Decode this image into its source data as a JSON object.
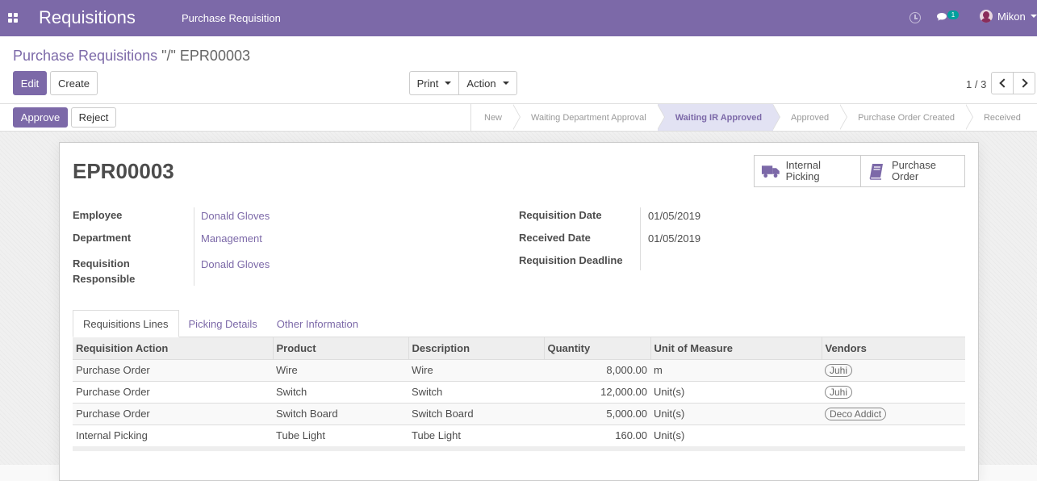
{
  "navbar": {
    "app_title": "Requisitions",
    "menu_item": "Purchase Requisition",
    "chat_count": "1",
    "user_name": "Mikon"
  },
  "breadcrumb": {
    "parent": "Purchase Requisitions",
    "separator": "\"/\"",
    "current": "EPR00003"
  },
  "toolbar": {
    "edit_label": "Edit",
    "create_label": "Create",
    "print_label": "Print",
    "action_label": "Action"
  },
  "pager": {
    "value": "1 / 3"
  },
  "status_buttons": {
    "approve_label": "Approve",
    "reject_label": "Reject"
  },
  "stages": [
    {
      "label": "New",
      "active": false
    },
    {
      "label": "Waiting Department Approval",
      "active": false
    },
    {
      "label": "Waiting IR Approved",
      "active": true
    },
    {
      "label": "Approved",
      "active": false
    },
    {
      "label": "Purchase Order Created",
      "active": false
    },
    {
      "label": "Received",
      "active": false
    }
  ],
  "record": {
    "name": "EPR00003",
    "smart_buttons": {
      "internal_picking": "Internal Picking",
      "purchase_order_line1": "Purchase",
      "purchase_order_line2": "Order"
    },
    "left_fields": {
      "employee_label": "Employee",
      "employee_value": "Donald Gloves",
      "department_label": "Department",
      "department_value": "Management",
      "responsible_label_line1": "Requisition",
      "responsible_label_line2": "Responsible",
      "responsible_value": "Donald Gloves"
    },
    "right_fields": {
      "req_date_label": "Requisition Date",
      "req_date_value": "01/05/2019",
      "received_date_label": "Received Date",
      "received_date_value": "01/05/2019",
      "deadline_label": "Requisition Deadline",
      "deadline_value": ""
    }
  },
  "tabs": [
    "Requisitions Lines",
    "Picking Details",
    "Other Information"
  ],
  "table": {
    "headers": [
      "Requisition Action",
      "Product",
      "Description",
      "Quantity",
      "Unit of Measure",
      "Vendors"
    ],
    "rows": [
      [
        "Purchase Order",
        "Wire",
        "Wire",
        "8,000.00",
        "m",
        "Juhi"
      ],
      [
        "Purchase Order",
        "Switch",
        "Switch",
        "12,000.00",
        "Unit(s)",
        "Juhi"
      ],
      [
        "Purchase Order",
        "Switch Board",
        "Switch Board",
        "5,000.00",
        "Unit(s)",
        "Deco Addict"
      ],
      [
        "Internal Picking",
        "Tube Light",
        "Tube Light",
        "160.00",
        "Unit(s)",
        ""
      ]
    ]
  },
  "colors": {
    "brand": "#7c69a8",
    "active_stage_bg": "#e2e2f3",
    "chat_badge": "#00a09d"
  }
}
